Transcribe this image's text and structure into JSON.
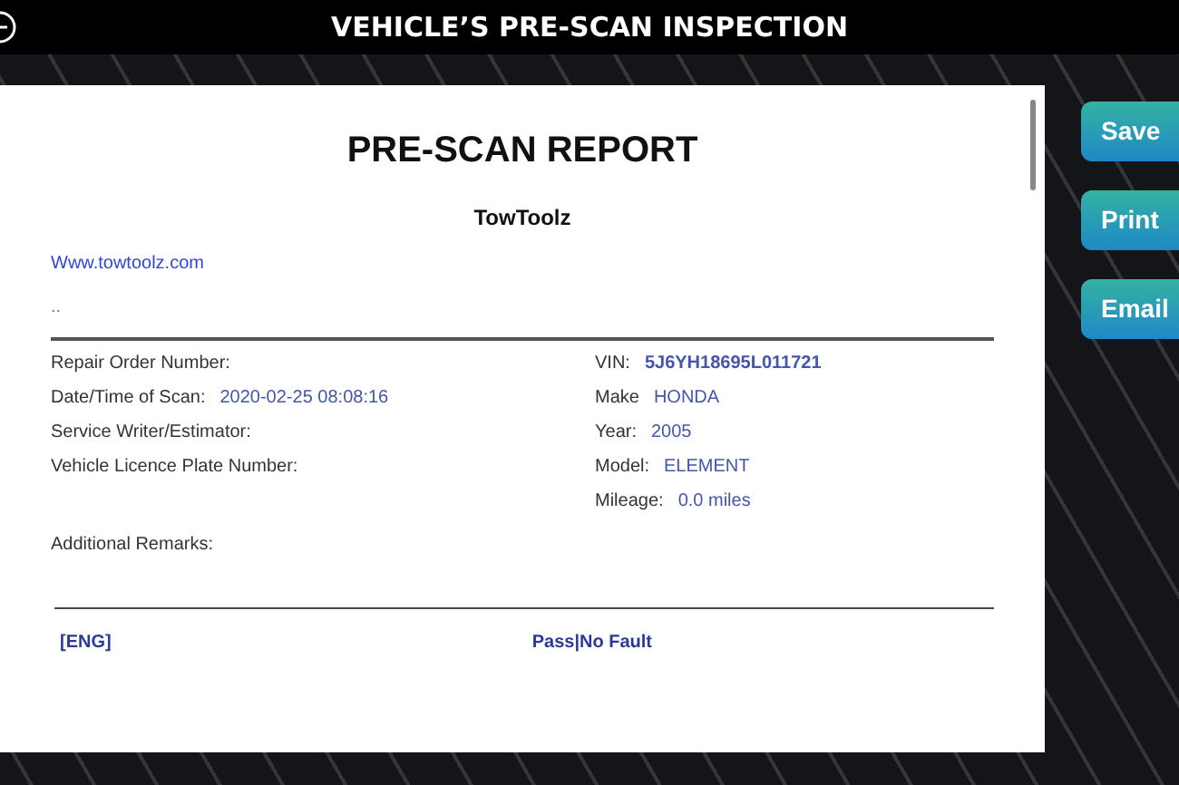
{
  "header": {
    "title": "VEHICLE’S PRE-SCAN INSPECTION"
  },
  "report": {
    "title": "PRE-SCAN REPORT",
    "company": "TowToolz",
    "website": "Www.towtoolz.com",
    "note": "..",
    "left_fields": [
      {
        "label": "Repair Order Number:"
      },
      {
        "label": "Date/Time of Scan:",
        "value": "2020-02-25 08:08:16"
      },
      {
        "label": "Service Writer/Estimator:"
      },
      {
        "label": "Vehicle Licence Plate Number:"
      }
    ],
    "right_fields": [
      {
        "label": "VIN:",
        "value": "5J6YH18695L011721",
        "bold": true
      },
      {
        "label": "Make",
        "value": "HONDA",
        "bold": false
      },
      {
        "label": "Year:",
        "value": "2005",
        "bold": false
      },
      {
        "label": "Model:",
        "value": "ELEMENT",
        "bold": false
      },
      {
        "label": "Mileage:",
        "value": "0.0 miles",
        "bold": false
      }
    ],
    "remarks_label": "Additional Remarks:",
    "results": [
      {
        "system": "[ENG]",
        "status": "Pass|No Fault"
      }
    ]
  },
  "buttons": [
    "Save",
    "Print",
    "Email"
  ]
}
